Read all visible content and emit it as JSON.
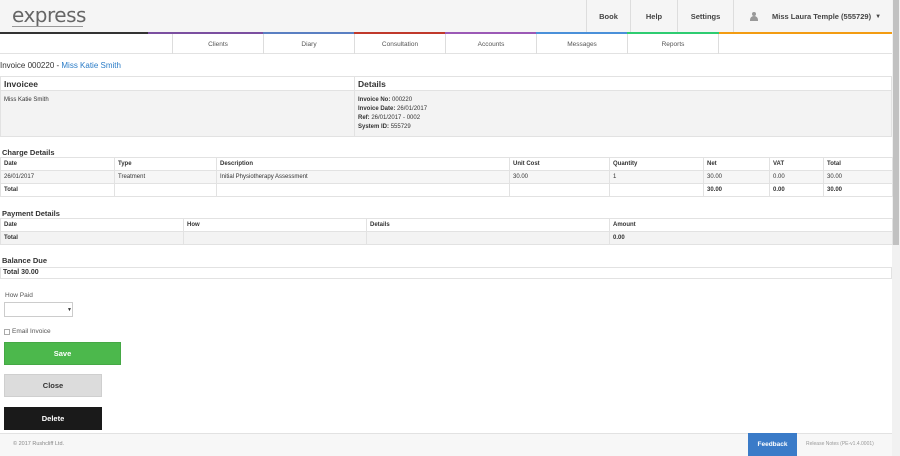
{
  "header": {
    "logo": "express",
    "nav": {
      "book": "Book",
      "help": "Help",
      "settings": "Settings"
    },
    "user": "Miss Laura Temple (555729)",
    "color_bar": [
      "#333333",
      "#7b4fa0",
      "#5a7fc2",
      "#c0392b",
      "#9b59b6",
      "#4a90d9",
      "#2ecc71",
      "#f39c12"
    ]
  },
  "subnav": {
    "tabs": [
      "Clients",
      "Diary",
      "Consultation",
      "Accounts",
      "Messages",
      "Reports"
    ]
  },
  "invoice": {
    "title_prefix": "Invoice 000220 - ",
    "client": "Miss Katie Smith"
  },
  "invoicee": {
    "heading": "Invoicee",
    "name": "Miss Katie Smith"
  },
  "details": {
    "heading": "Details",
    "invoice_no_label": "Invoice No:",
    "invoice_no": "000220",
    "invoice_date_label": "Invoice Date:",
    "invoice_date": "26/01/2017",
    "ref_label": "Ref:",
    "ref": "26/01/2017 - 0002",
    "system_id_label": "System ID:",
    "system_id": "555729"
  },
  "charges": {
    "heading": "Charge Details",
    "columns": [
      "Date",
      "Type",
      "Description",
      "Unit Cost",
      "Quantity",
      "Net",
      "VAT",
      "Total"
    ],
    "rows": [
      [
        "26/01/2017",
        "Treatment",
        "Initial Physiotherapy Assessment",
        "30.00",
        "1",
        "30.00",
        "0.00",
        "30.00"
      ]
    ],
    "total_label": "Total",
    "total_net": "30.00",
    "total_vat": "0.00",
    "total_total": "30.00"
  },
  "payments": {
    "heading": "Payment Details",
    "columns": [
      "Date",
      "How",
      "Details",
      "Amount"
    ],
    "total_label": "Total",
    "total_amount": "0.00"
  },
  "balance": {
    "heading": "Balance Due",
    "total": "Total 30.00"
  },
  "form": {
    "how_paid_label": "How Paid",
    "how_paid_value": "",
    "email_invoice_label": "Email Invoice",
    "email_invoice_checked": false,
    "save": "Save",
    "close": "Close",
    "delete": "Delete"
  },
  "footer": {
    "copyright": "© 2017 Rushcliff Ltd.",
    "feedback": "Feedback",
    "release": "Release Notes (PE-v1.4.0001)"
  }
}
